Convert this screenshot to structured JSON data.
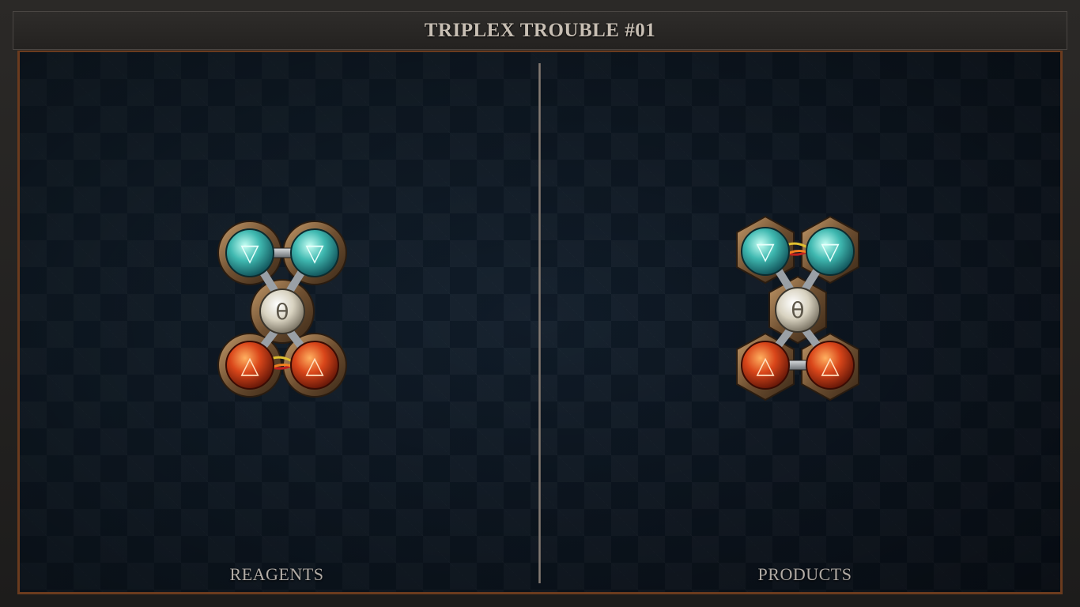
{
  "header": {
    "title": "TRIPLEX TROUBLE #01"
  },
  "panels": {
    "reagents": {
      "label": "REAGENTS",
      "atoms": [
        {
          "element": "water",
          "symbol": "▽",
          "color": "#3fb8b0"
        },
        {
          "element": "water",
          "symbol": "▽",
          "color": "#3fb8b0"
        },
        {
          "element": "salt",
          "symbol": "θ",
          "color": "#d8d2c0"
        },
        {
          "element": "fire",
          "symbol": "△",
          "color": "#d9461a"
        },
        {
          "element": "fire",
          "symbol": "△",
          "color": "#d9461a"
        }
      ],
      "bonds": [
        {
          "from": 0,
          "to": 1,
          "type": "normal"
        },
        {
          "from": 0,
          "to": 2,
          "type": "normal"
        },
        {
          "from": 1,
          "to": 2,
          "type": "normal"
        },
        {
          "from": 2,
          "to": 3,
          "type": "normal"
        },
        {
          "from": 2,
          "to": 4,
          "type": "normal"
        },
        {
          "from": 3,
          "to": 4,
          "type": "triplex"
        }
      ]
    },
    "products": {
      "label": "PRODUCTS",
      "atoms": [
        {
          "element": "water",
          "symbol": "▽",
          "color": "#3fb8b0"
        },
        {
          "element": "water",
          "symbol": "▽",
          "color": "#3fb8b0"
        },
        {
          "element": "salt",
          "symbol": "θ",
          "color": "#d8d2c0"
        },
        {
          "element": "fire",
          "symbol": "△",
          "color": "#d9461a"
        },
        {
          "element": "fire",
          "symbol": "△",
          "color": "#d9461a"
        }
      ],
      "bonds": [
        {
          "from": 0,
          "to": 1,
          "type": "triplex"
        },
        {
          "from": 0,
          "to": 2,
          "type": "normal"
        },
        {
          "from": 1,
          "to": 2,
          "type": "normal"
        },
        {
          "from": 2,
          "to": 3,
          "type": "normal"
        },
        {
          "from": 2,
          "to": 4,
          "type": "normal"
        },
        {
          "from": 3,
          "to": 4,
          "type": "normal"
        }
      ]
    }
  },
  "colors": {
    "frame_accent": "#6b3b1e",
    "metal": "#8a6a45",
    "board": "#0e1a26"
  }
}
